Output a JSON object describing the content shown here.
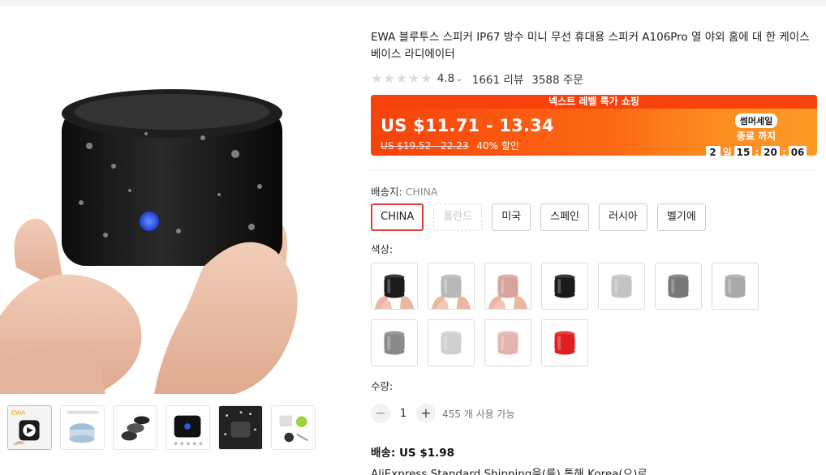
{
  "product": {
    "title": "EWA 블루투스 스피커 IP67 방수 미니 무선 휴대용 스피커 A106Pro 열 야외 홈에 대 한 케이스베이스 라디에이터",
    "rating": "4.8",
    "reviews": "1661 리뷰",
    "orders": "3588 주문"
  },
  "promo": {
    "header": "넥스트 레벨 특가 쇼핑",
    "price": "US $11.71 - 13.34",
    "original_price": "US $19.52 - 22.23",
    "discount": "40% 할인",
    "sale_badge": "썸머세일",
    "sale_end": "종료 까지",
    "countdown": {
      "days": "2",
      "day_unit": "일",
      "hours": "15",
      "minutes": "20",
      "seconds": "06",
      "separator": ":"
    },
    "colors": {
      "primary": "#f7420c",
      "secondary": "#fd9b26"
    }
  },
  "ship_from": {
    "label": "배송지:",
    "selected": "CHINA",
    "options": [
      {
        "label": "CHINA",
        "state": "selected"
      },
      {
        "label": "폴란드",
        "state": "disabled"
      },
      {
        "label": "미국",
        "state": "normal"
      },
      {
        "label": "스페인",
        "state": "normal"
      },
      {
        "label": "러시아",
        "state": "normal"
      },
      {
        "label": "벨기에",
        "state": "normal"
      }
    ]
  },
  "color": {
    "label": "색상:",
    "swatches": [
      {
        "name": "black-in-hand",
        "color": "#1a1a1a"
      },
      {
        "name": "silver-in-hand",
        "color": "#b8b8b8"
      },
      {
        "name": "rose-gold-in-hand",
        "color": "#d8a39d"
      },
      {
        "name": "black",
        "color": "#1b1b1b"
      },
      {
        "name": "silver",
        "color": "#c4c4c4"
      },
      {
        "name": "gunmetal",
        "color": "#777777"
      },
      {
        "name": "silver-grey",
        "color": "#a9a9a9"
      },
      {
        "name": "dark-grey",
        "color": "#8a8a8a"
      },
      {
        "name": "light-silver",
        "color": "#cfcfcf"
      },
      {
        "name": "pink",
        "color": "#e3b3ad"
      },
      {
        "name": "red",
        "color": "#e02020"
      }
    ]
  },
  "quantity": {
    "label": "수량:",
    "value": "1",
    "minus": "−",
    "plus": "+",
    "available": "455 개 사용 가능"
  },
  "shipping": {
    "fee": "배송: US $1.98",
    "method": "AliExpress Standard Shipping을(를) 통해 Korea(으)로"
  },
  "icons": {
    "star": "star-icon",
    "chevron": "chevron-down-icon"
  },
  "thumbnails": [
    "video-thumb",
    "white-speaker",
    "exploded-view",
    "black-speaker",
    "rain-splash",
    "accessories"
  ]
}
